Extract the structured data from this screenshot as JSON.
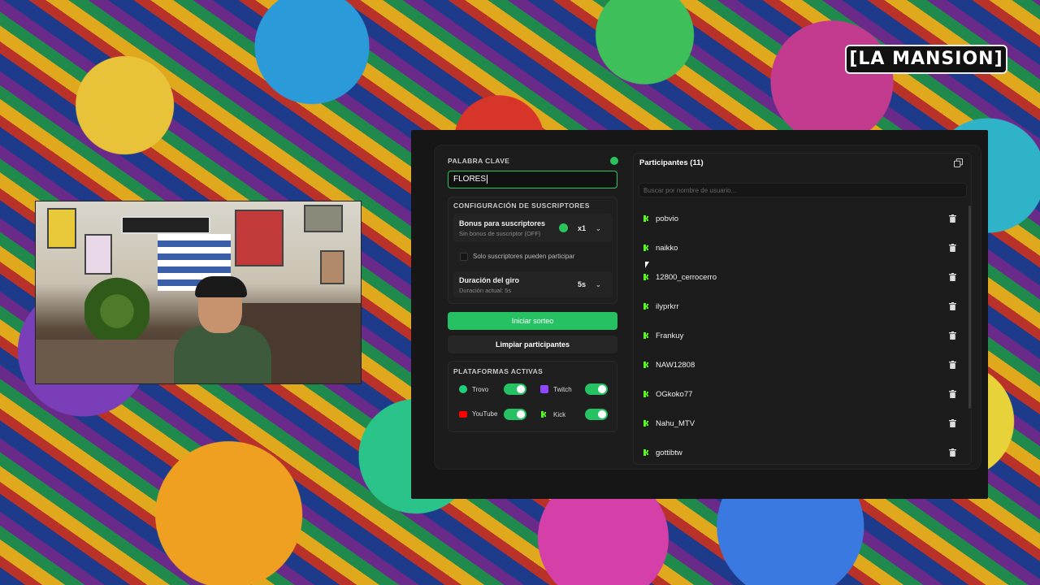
{
  "overlay": {
    "logo_text": "[LA MANSION]"
  },
  "keyword": {
    "label": "PALABRA CLAVE",
    "value": "FLORES"
  },
  "subs_config": {
    "title": "CONFIGURACIÓN DE SUSCRIPTORES",
    "bonus_title": "Bonus para suscriptores",
    "bonus_sub": "Sin bonus de suscriptor (OFF)",
    "bonus_value": "x1",
    "only_subs_label": "Solo suscriptores pueden participar",
    "duration_title": "Duración del giro",
    "duration_sub": "Duración actual: 5s",
    "duration_value": "5s"
  },
  "buttons": {
    "start": "Iniciar sorteo",
    "clear": "Limpiar participantes"
  },
  "platforms": {
    "title": "PLATAFORMAS ACTIVAS",
    "items": [
      {
        "name": "Trovo",
        "color": "#1fd07a",
        "enabled": true
      },
      {
        "name": "Twitch",
        "color": "#9146ff",
        "enabled": true
      },
      {
        "name": "YouTube",
        "color": "#ff0000",
        "enabled": true
      },
      {
        "name": "Kick",
        "color": "#53fc18",
        "enabled": true
      }
    ]
  },
  "participants": {
    "title": "Participantes (11)",
    "search_placeholder": "Buscar por nombre de usuario...",
    "list": [
      "pobvio",
      "naikko",
      "12800_cerrocerro",
      "ilyprkrr",
      "Frankuy",
      "NAW12808",
      "OGkoko77",
      "Nahu_MTV",
      "gottibtw"
    ]
  },
  "colors": {
    "accent": "#26c163",
    "kick": "#53fc18"
  }
}
